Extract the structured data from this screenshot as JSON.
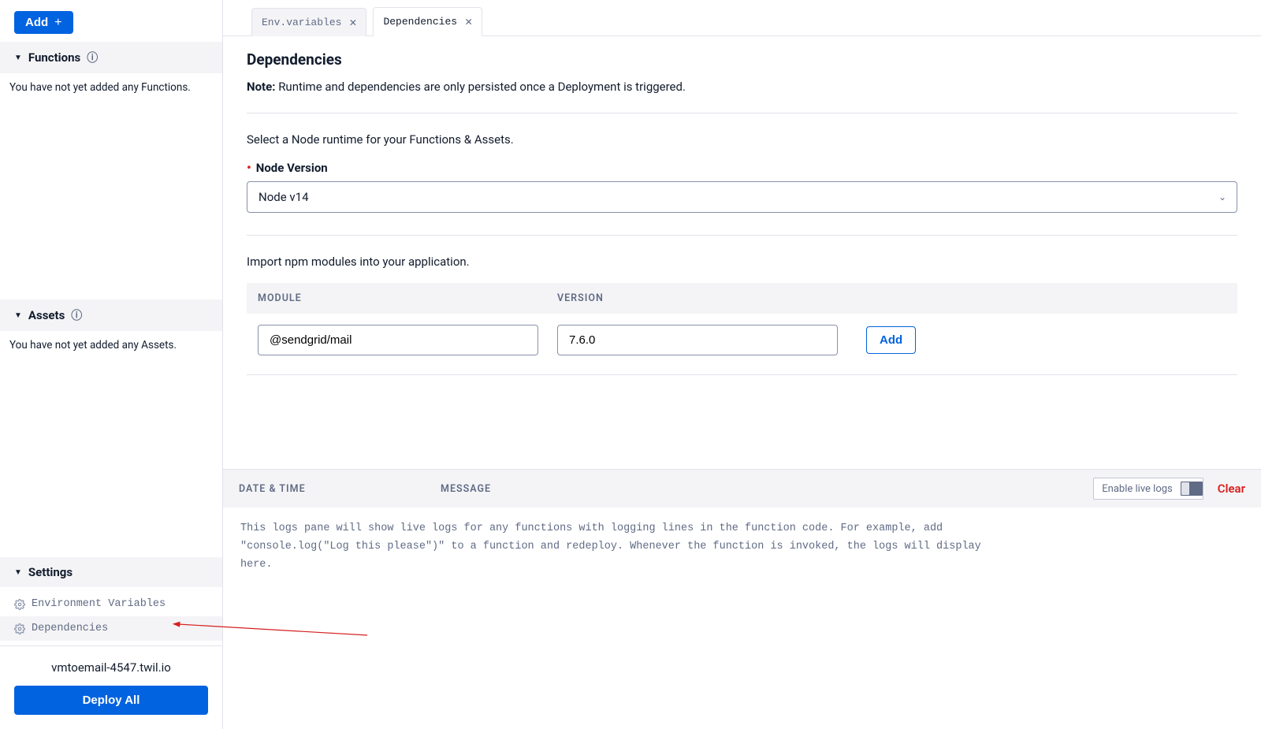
{
  "sidebar": {
    "add_label": "Add",
    "sections": {
      "functions": {
        "title": "Functions",
        "empty": "You have not yet added any Functions."
      },
      "assets": {
        "title": "Assets",
        "empty": "You have not yet added any Assets."
      },
      "settings": {
        "title": "Settings"
      }
    },
    "settings_items": [
      {
        "label": "Environment Variables"
      },
      {
        "label": "Dependencies"
      }
    ],
    "domain": "vmtoemail-4547.twil.io",
    "deploy_label": "Deploy All"
  },
  "tabs": [
    {
      "label": "Env.variables",
      "active": false
    },
    {
      "label": "Dependencies",
      "active": true
    }
  ],
  "page": {
    "title": "Dependencies",
    "note_label": "Note:",
    "note_text": "Runtime and dependencies are only persisted once a Deployment is triggered.",
    "runtime_helper": "Select a Node runtime for your Functions & Assets.",
    "node_version_label": "Node Version",
    "node_version_value": "Node v14",
    "import_helper": "Import npm modules into your application.",
    "table": {
      "module_header": "MODULE",
      "version_header": "VERSION"
    },
    "module_input": "@sendgrid/mail",
    "version_input": "7.6.0",
    "add_dep_label": "Add"
  },
  "logs": {
    "date_header": "DATE & TIME",
    "message_header": "MESSAGE",
    "enable_live_label": "Enable live logs",
    "clear_label": "Clear",
    "body": "This logs pane will show live logs for any functions with logging lines in the function code. For example, add \"console.log(\"Log this please\")\" to a function and redeploy. Whenever the function is invoked, the logs will display here."
  }
}
